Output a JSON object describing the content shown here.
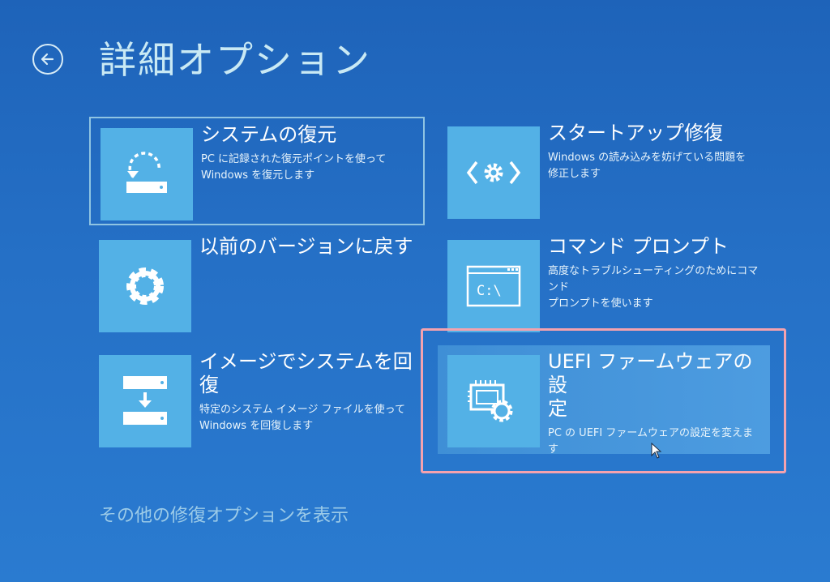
{
  "header": {
    "title": "詳細オプション",
    "back_icon": "back-arrow-icon"
  },
  "tiles": [
    {
      "title": "システムの復元",
      "description_lines": [
        "PC に記録された復元ポイントを使って",
        "Windows を復元します"
      ],
      "icon": "system-restore-icon"
    },
    {
      "title": "スタートアップ修復",
      "description_lines": [
        "Windows の読み込みを妨げている問題を",
        "修正します"
      ],
      "icon": "startup-repair-icon"
    },
    {
      "title": "以前のバージョンに戻す",
      "description_lines": [],
      "icon": "gear-icon"
    },
    {
      "title": "コマンド プロンプト",
      "description_lines": [
        "高度なトラブルシューティングのためにコマンド",
        "プロンプトを使います"
      ],
      "icon": "command-prompt-icon",
      "icon_text": "C:\\"
    },
    {
      "title_lines": [
        "イメージでシステムを回",
        "復"
      ],
      "description_lines": [
        "特定のシステム イメージ ファイルを使って",
        "Windows を回復します"
      ],
      "icon": "system-image-icon"
    },
    {
      "title_lines": [
        "UEFI ファームウェアの設",
        "定"
      ],
      "description_lines": [
        "PC の UEFI ファームウェアの設定を変えます"
      ],
      "icon": "uefi-settings-icon"
    }
  ],
  "footer": {
    "link": "その他の修復オプションを表示"
  },
  "colors": {
    "background": "#2570c6",
    "tile_icon_bg": "#53b1e6",
    "highlight": "#f4a2ae",
    "title_text": "#c9e9f4"
  }
}
